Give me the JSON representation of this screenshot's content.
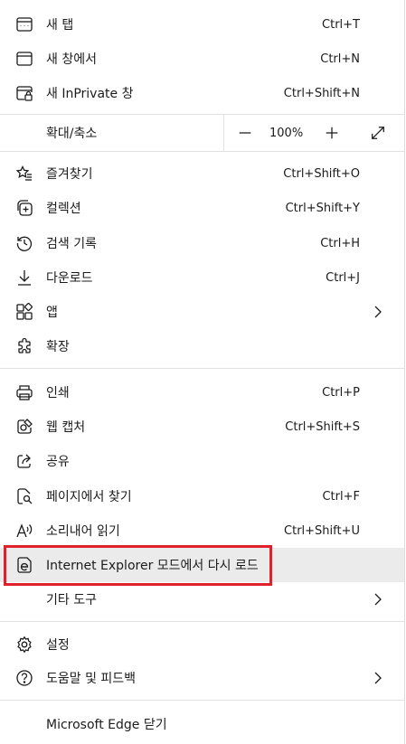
{
  "menu": {
    "new_tab": {
      "label": "새 탭",
      "shortcut": "Ctrl+T"
    },
    "new_window": {
      "label": "새 창에서",
      "shortcut": "Ctrl+N"
    },
    "new_inprivate": {
      "label": "새 InPrivate 창",
      "shortcut": "Ctrl+Shift+N"
    },
    "zoom": {
      "label": "확대/축소",
      "value": "100%"
    },
    "favorites": {
      "label": "즐겨찾기",
      "shortcut": "Ctrl+Shift+O"
    },
    "collections": {
      "label": "컬렉션",
      "shortcut": "Ctrl+Shift+Y"
    },
    "history": {
      "label": "검색 기록",
      "shortcut": "Ctrl+H"
    },
    "downloads": {
      "label": "다운로드",
      "shortcut": "Ctrl+J"
    },
    "apps": {
      "label": "앱"
    },
    "extensions": {
      "label": "확장"
    },
    "print": {
      "label": "인쇄",
      "shortcut": "Ctrl+P"
    },
    "web_capture": {
      "label": "웹 캡처",
      "shortcut": "Ctrl+Shift+S"
    },
    "share": {
      "label": "공유"
    },
    "find": {
      "label": "페이지에서 찾기",
      "shortcut": "Ctrl+F"
    },
    "read_aloud": {
      "label": "소리내어 읽기",
      "shortcut": "Ctrl+Shift+U"
    },
    "ie_mode": {
      "label": "Internet Explorer 모드에서 다시 로드"
    },
    "more_tools": {
      "label": "기타 도구"
    },
    "settings": {
      "label": "설정"
    },
    "help": {
      "label": "도움말 및 피드백"
    },
    "close": {
      "label": "Microsoft Edge 닫기"
    }
  },
  "colors": {
    "highlight_box": "#e0202a",
    "hover_bg": "#ebebeb"
  }
}
